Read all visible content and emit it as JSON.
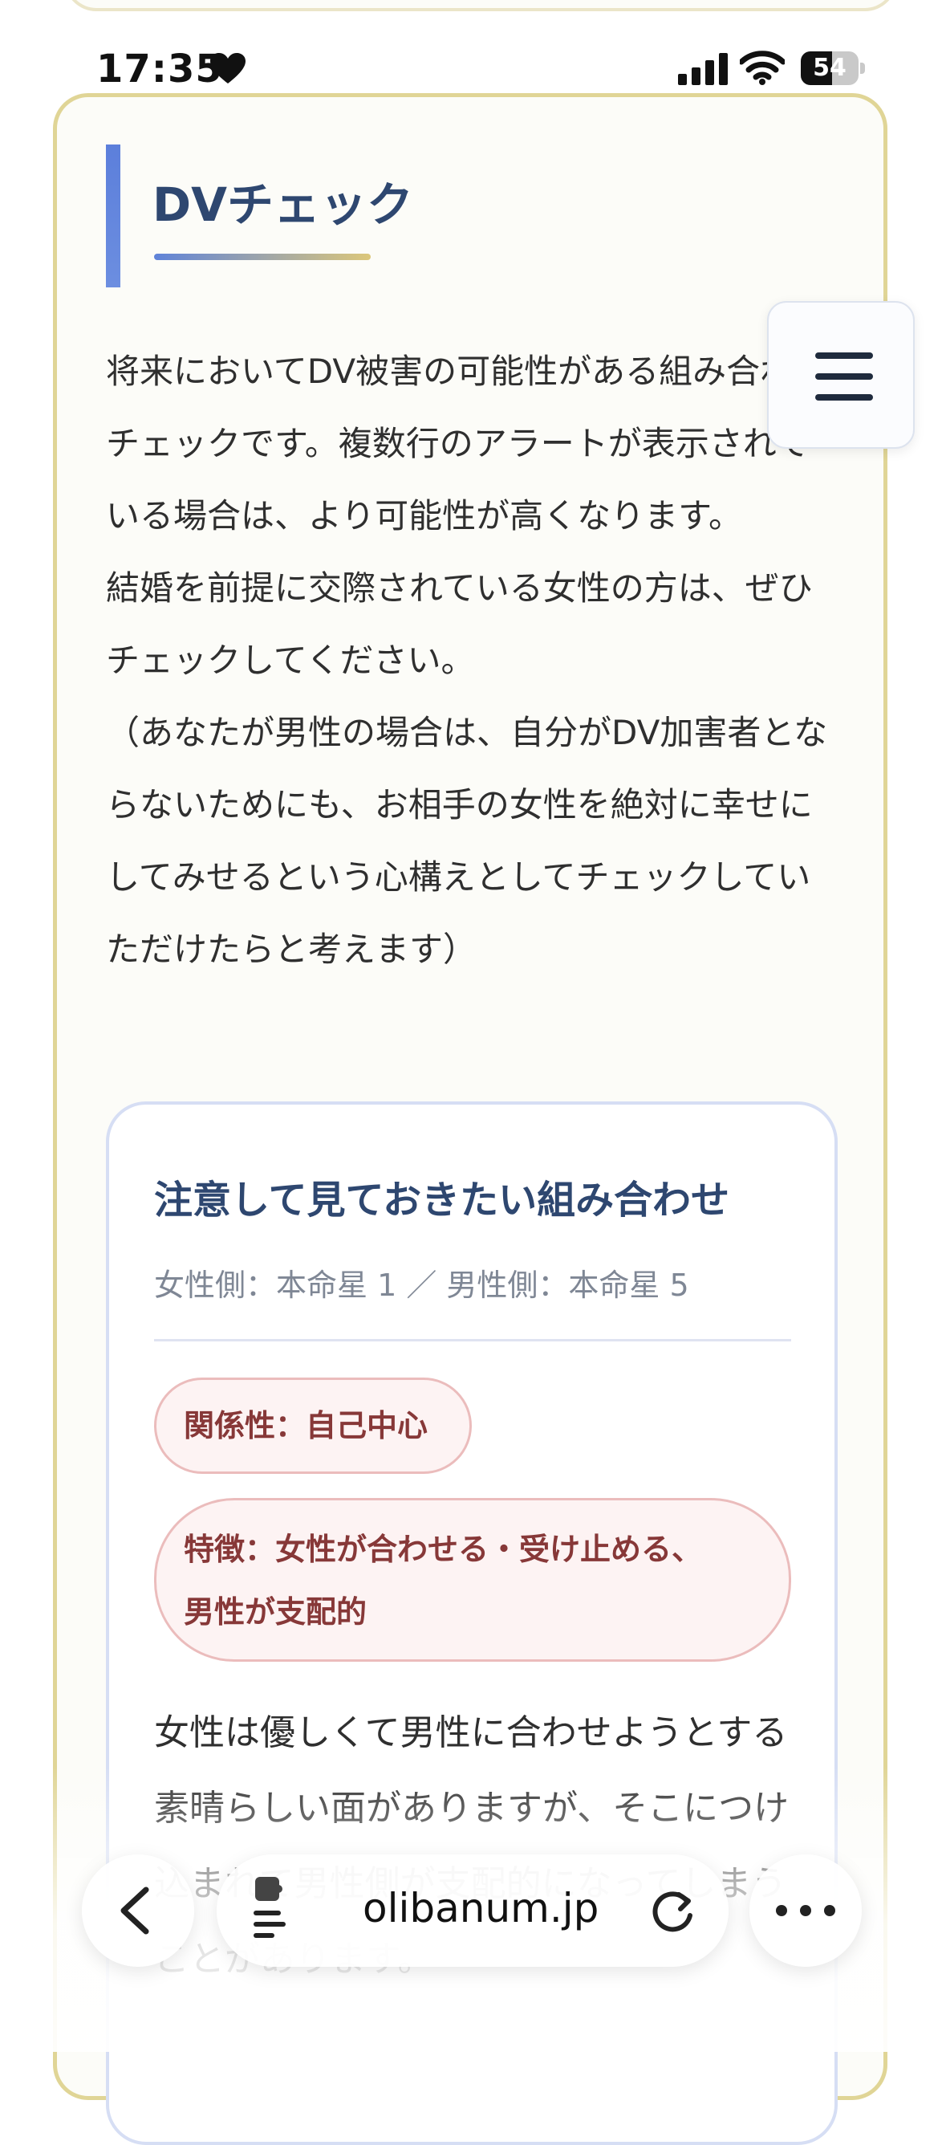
{
  "status_bar": {
    "time": "17:35",
    "battery_level": "54",
    "battery_fraction": 0.54
  },
  "section": {
    "heading": "DVチェック",
    "intro_paragraphs": [
      "将来においてDV被害の可能性がある組み合わせチェックです。複数行のアラートが表示されている場合は、より可能性が高くなります。",
      "結婚を前提に交際されている女性の方は、ぜひチェックしてください。",
      "（あなたが男性の場合は、自分がDV加害者とならないためにも、お相手の女性を絶対に幸せにしてみせるという心構えとしてチェックしていただけたらと考えます）"
    ]
  },
  "result_card": {
    "title": "注意して見ておきたい組み合わせ",
    "subtitle": "女性側：本命星 1 ／ 男性側：本命星 5",
    "badge_relationship": "関係性：自己中心",
    "badge_feature_line1": "特徴：女性が合わせる・受け止める、",
    "badge_feature_line2": "男性が支配的",
    "body": "女性は優しくて男性に合わせようとする素晴らしい面がありますが、そこにつけ込まれて男性側が支配的になってしまうことがあります。"
  },
  "browser": {
    "url": "olibanum.jp"
  },
  "icons": {
    "heart": "heart-icon",
    "signal": "cellular-signal-icon",
    "wifi": "wifi-icon",
    "battery": "battery-icon",
    "menu": "hamburger-menu-icon",
    "back": "chevron-left-icon",
    "extension": "extension-puzzle-icon",
    "reload": "reload-icon",
    "more": "more-ellipsis-icon"
  },
  "colors": {
    "card_border": "#e0d596",
    "heading": "#2e4770",
    "accent_blue": "#5c7fdb",
    "badge_text": "#873838",
    "badge_bg": "#fdf3f3"
  }
}
